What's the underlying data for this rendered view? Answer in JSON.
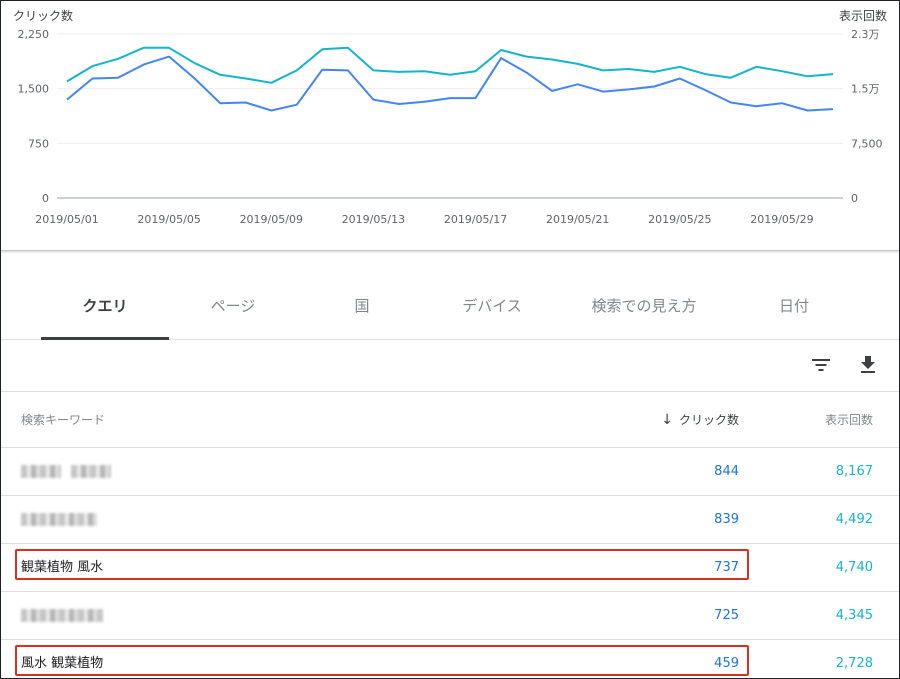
{
  "chart_data": {
    "type": "line",
    "x": [
      "2019/05/01",
      "2019/05/02",
      "2019/05/03",
      "2019/05/04",
      "2019/05/05",
      "2019/05/06",
      "2019/05/07",
      "2019/05/08",
      "2019/05/09",
      "2019/05/10",
      "2019/05/11",
      "2019/05/12",
      "2019/05/13",
      "2019/05/14",
      "2019/05/15",
      "2019/05/16",
      "2019/05/17",
      "2019/05/18",
      "2019/05/19",
      "2019/05/20",
      "2019/05/21",
      "2019/05/22",
      "2019/05/23",
      "2019/05/24",
      "2019/05/25",
      "2019/05/26",
      "2019/05/27",
      "2019/05/28",
      "2019/05/29",
      "2019/05/30",
      "2019/05/31"
    ],
    "x_tick_labels": [
      "2019/05/01",
      "2019/05/05",
      "2019/05/09",
      "2019/05/13",
      "2019/05/17",
      "2019/05/21",
      "2019/05/25",
      "2019/05/29"
    ],
    "y_left_title": "クリック数",
    "y_right_title": "表示回数",
    "y_left_ticks": [
      "0",
      "750",
      "1,500",
      "2,250"
    ],
    "y_right_ticks": [
      "0",
      "7,500",
      "1.5万",
      "2.3万"
    ],
    "ylim_left": [
      0,
      2250
    ],
    "ylim_right": [
      0,
      22500
    ],
    "grid": true,
    "series": [
      {
        "name": "クリック数",
        "axis": "left",
        "color": "#4285f4",
        "values": [
          1350,
          1640,
          1650,
          1830,
          1940,
          1640,
          1300,
          1310,
          1200,
          1280,
          1760,
          1750,
          1350,
          1290,
          1320,
          1370,
          1370,
          1920,
          1720,
          1470,
          1560,
          1460,
          1490,
          1530,
          1640,
          1480,
          1310,
          1260,
          1300,
          1200,
          1220
        ]
      },
      {
        "name": "表示回数",
        "axis": "right",
        "color": "#12b5cb",
        "values": [
          16000,
          18100,
          19100,
          20600,
          20600,
          18500,
          16900,
          16400,
          15800,
          17500,
          20400,
          20600,
          17500,
          17300,
          17400,
          16900,
          17400,
          20300,
          19400,
          19000,
          18400,
          17500,
          17700,
          17300,
          18000,
          17000,
          16500,
          18000,
          17400,
          16700,
          17000
        ]
      }
    ]
  },
  "tabs": [
    {
      "label": "クエリ",
      "active": true
    },
    {
      "label": "ページ",
      "active": false
    },
    {
      "label": "国",
      "active": false
    },
    {
      "label": "デバイス",
      "active": false
    },
    {
      "label": "検索での見え方",
      "active": false
    },
    {
      "label": "日付",
      "active": false
    }
  ],
  "table": {
    "headers": {
      "query": "検索キーワード",
      "clicks": "クリック数",
      "impressions": "表示回数"
    },
    "sort_arrow": "↓",
    "rows": [
      {
        "query": "",
        "clicks": "844",
        "impressions": "8,167"
      },
      {
        "query": "",
        "clicks": "839",
        "impressions": "4,492"
      },
      {
        "query": "観葉植物 風水",
        "clicks": "737",
        "impressions": "4,740"
      },
      {
        "query": "",
        "clicks": "725",
        "impressions": "4,345"
      },
      {
        "query": "風水 観葉植物",
        "clicks": "459",
        "impressions": "2,728"
      }
    ]
  },
  "colors": {
    "accent_blue": "#1a73e8",
    "accent_teal": "#12b5cb",
    "highlight": "#d93025"
  }
}
